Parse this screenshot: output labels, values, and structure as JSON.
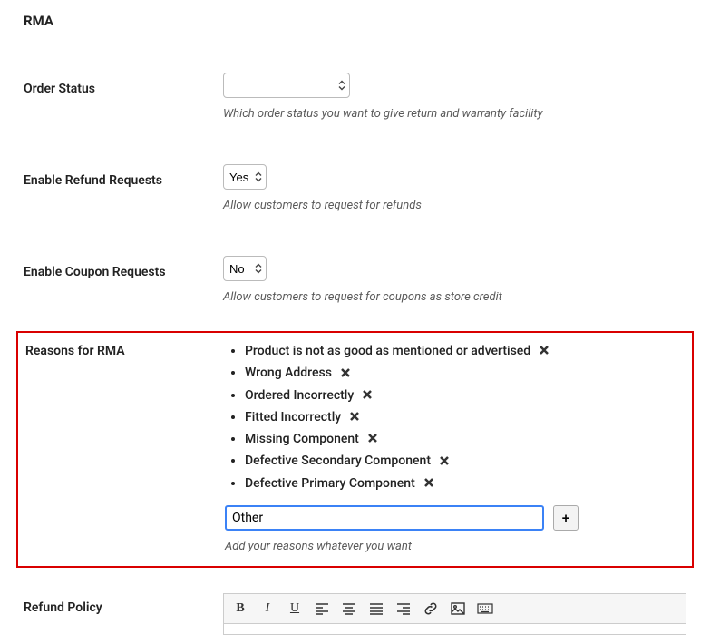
{
  "heading": "RMA",
  "order_status": {
    "label": "Order Status",
    "value": "",
    "hint": "Which order status you want to give return and warranty facility"
  },
  "refund_requests": {
    "label": "Enable Refund Requests",
    "value": "Yes",
    "hint": "Allow customers to request for refunds"
  },
  "coupon_requests": {
    "label": "Enable Coupon Requests",
    "value": "No",
    "hint": "Allow customers to request for coupons as store credit"
  },
  "reasons": {
    "label": "Reasons for RMA",
    "items": [
      "Product is not as good as mentioned or advertised",
      "Wrong Address",
      "Ordered Incorrectly",
      "Fitted Incorrectly",
      "Missing Component",
      "Defective Secondary Component",
      "Defective Primary Component"
    ],
    "input_value": "Other",
    "add_label": "+",
    "hint": "Add your reasons whatever you want"
  },
  "refund_policy": {
    "label": "Refund Policy"
  }
}
